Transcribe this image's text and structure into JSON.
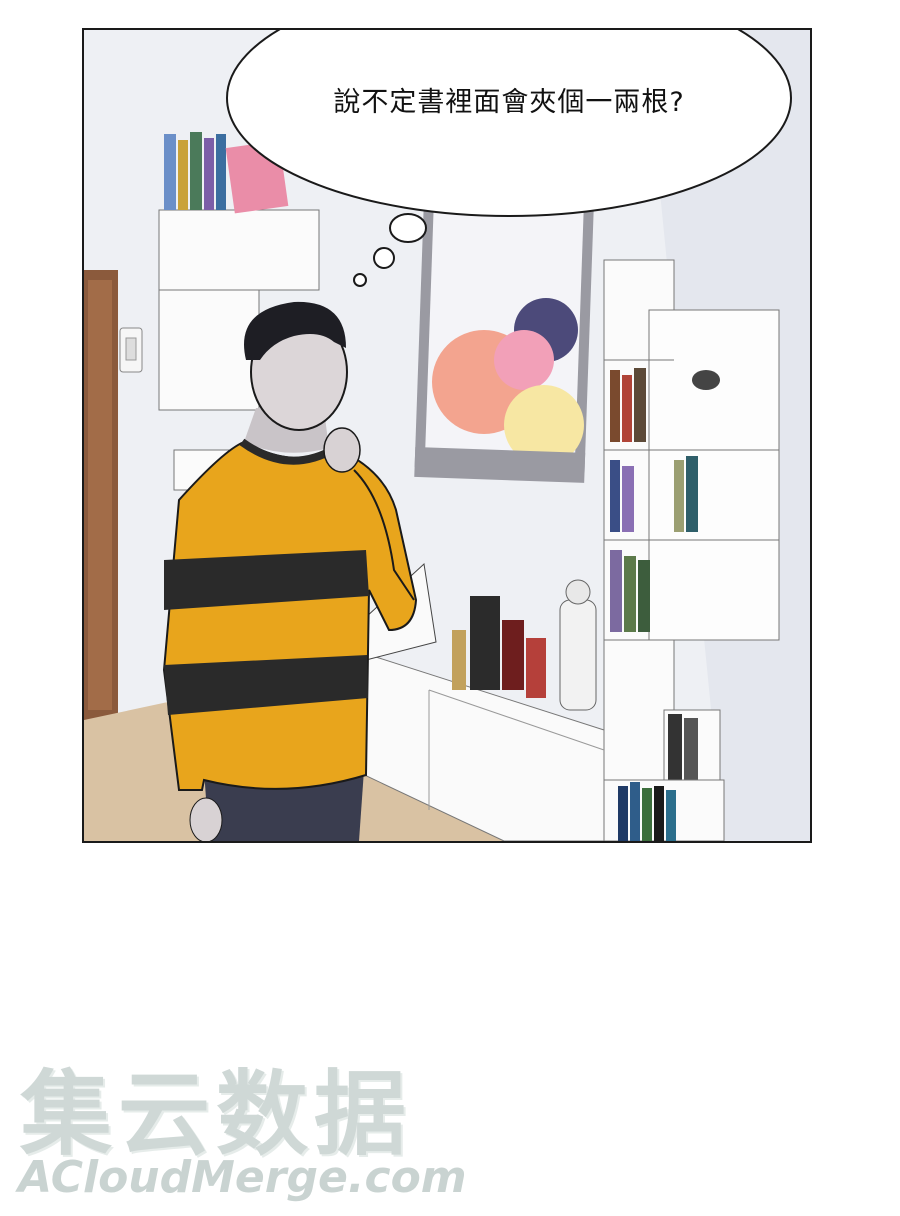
{
  "panel": {
    "speech_bubble": {
      "text": "說不定書裡面會夾個一兩根?"
    }
  },
  "watermark": {
    "cjk_text": "集云数据",
    "latin_text": "ACloudMerge.com"
  },
  "colors": {
    "sweater_yellow": "#e8a51c",
    "sweater_stripe": "#2a2a2a",
    "wall": "#eef0f4",
    "floor": "#d9c2a3",
    "watermark": "#cfd8d6"
  }
}
